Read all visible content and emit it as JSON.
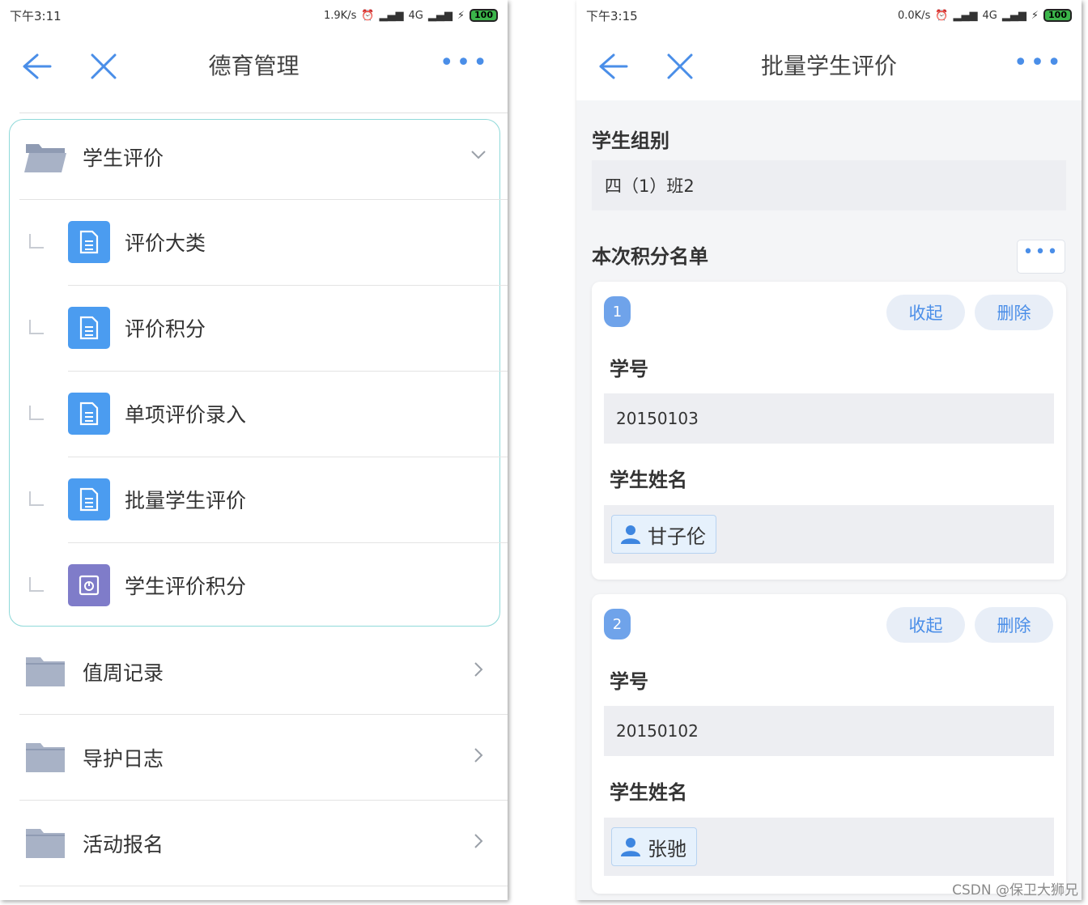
{
  "left": {
    "status": {
      "time": "下午3:11",
      "speed": "1.9K/s",
      "network": "4G",
      "battery": "100"
    },
    "nav": {
      "title": "德育管理"
    },
    "groups": [
      {
        "label": "学生评价"
      },
      {
        "label": "值周记录"
      },
      {
        "label": "导护日志"
      },
      {
        "label": "活动报名"
      }
    ],
    "sub_items": [
      {
        "label": "评价大类"
      },
      {
        "label": "评价积分"
      },
      {
        "label": "单项评价录入"
      },
      {
        "label": "批量学生评价"
      },
      {
        "label": "学生评价积分"
      }
    ],
    "colors": {
      "accent": "#4a8ee8",
      "doc_icon": "#4b9cf0",
      "report_icon": "#7f7cc9",
      "group_border": "#8fd9d9"
    }
  },
  "right": {
    "status": {
      "time": "下午3:15",
      "speed": "0.0K/s",
      "network": "4G",
      "battery": "100"
    },
    "nav": {
      "title": "批量学生评价"
    },
    "group_label": "学生组别",
    "group_value": "四（1）班2",
    "list_label": "本次积分名单",
    "collapse_label": "收起",
    "delete_label": "删除",
    "id_label": "学号",
    "name_label": "学生姓名",
    "entries": [
      {
        "num": "1",
        "id": "20150103",
        "name": "甘子伦"
      },
      {
        "num": "2",
        "id": "20150102",
        "name": "张驰"
      }
    ]
  },
  "watermark": "CSDN @保卫大狮兄"
}
